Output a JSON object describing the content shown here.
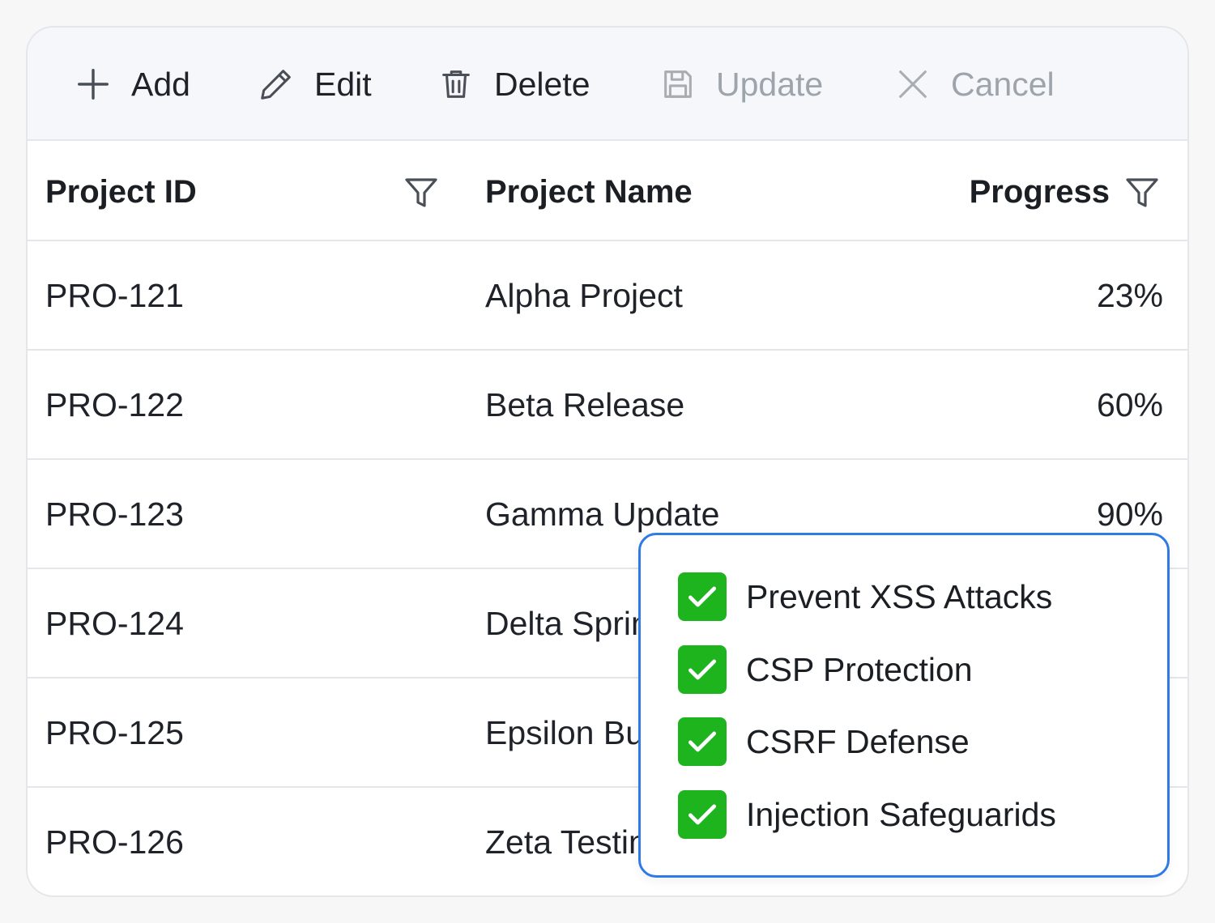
{
  "toolbar": {
    "add_label": "Add",
    "edit_label": "Edit",
    "delete_label": "Delete",
    "update_label": "Update",
    "cancel_label": "Cancel"
  },
  "table": {
    "columns": [
      "Project ID",
      "Project Name",
      "Progress"
    ],
    "rows": [
      {
        "id": "PRO-121",
        "name": "Alpha Project",
        "progress": "23%"
      },
      {
        "id": "PRO-122",
        "name": "Beta Release",
        "progress": "60%"
      },
      {
        "id": "PRO-123",
        "name": "Gamma Update",
        "progress": "90%"
      },
      {
        "id": "PRO-124",
        "name": "Delta Sprint",
        "progress": ""
      },
      {
        "id": "PRO-125",
        "name": "Epsilon Build",
        "progress": ""
      },
      {
        "id": "PRO-126",
        "name": "Zeta Testing",
        "progress": ""
      }
    ]
  },
  "filter_popup": {
    "options": [
      {
        "label": "Prevent XSS Attacks",
        "checked": true
      },
      {
        "label": "CSP Protection",
        "checked": true
      },
      {
        "label": "CSRF Defense",
        "checked": true
      },
      {
        "label": "Injection Safeguarids",
        "checked": true
      }
    ]
  },
  "colors": {
    "accent": "#2f7ae5",
    "checkbox": "#1db41d",
    "toolbar_bg": "#f5f7fb",
    "disabled_text": "#9ea4ab"
  },
  "icons": {
    "add": "plus-icon",
    "edit": "pencil-icon",
    "delete": "trash-icon",
    "update": "save-icon",
    "cancel": "close-icon",
    "filter": "filter-icon",
    "check": "checkmark-icon"
  }
}
